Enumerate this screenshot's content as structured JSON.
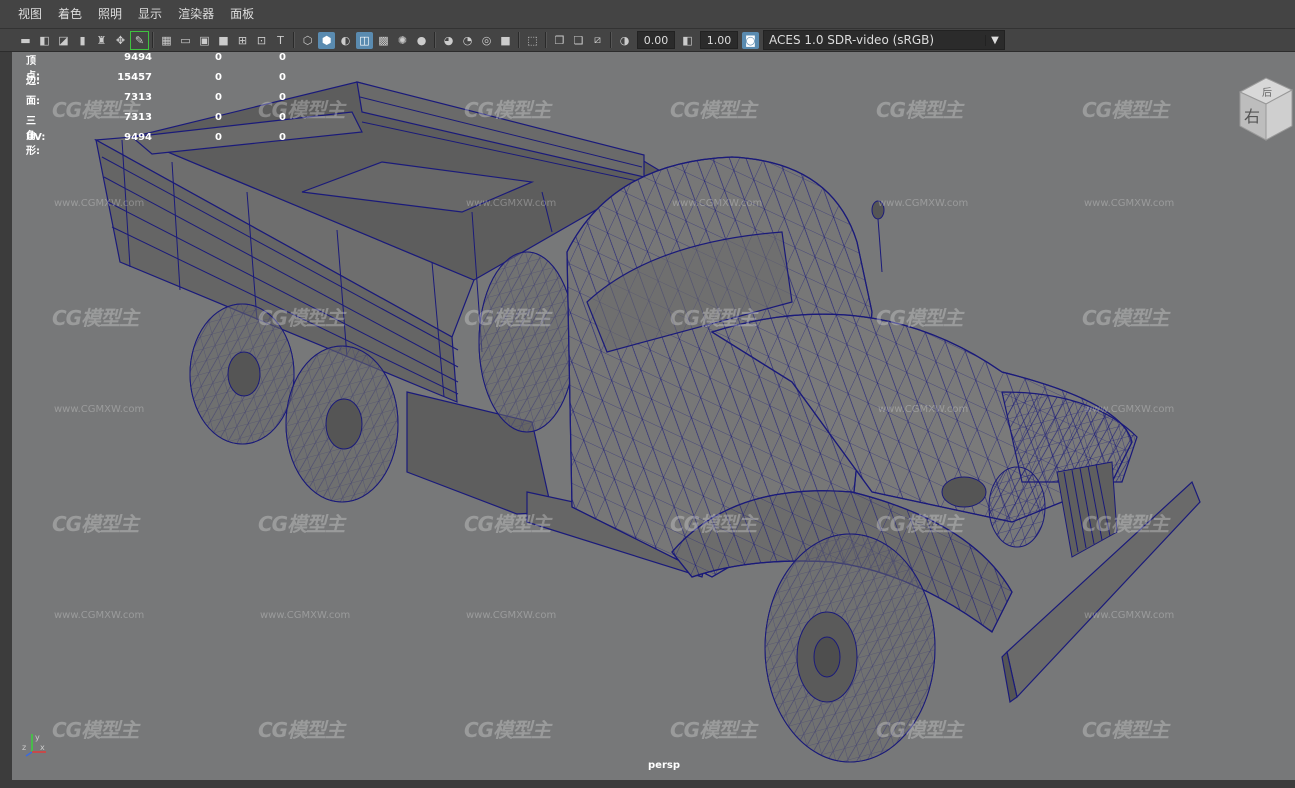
{
  "menu": [
    "视图",
    "着色",
    "照明",
    "显示",
    "渲染器",
    "面板"
  ],
  "toolbar": {
    "exposure_value": "0.00",
    "gamma_value": "1.00",
    "color_space": "ACES 1.0 SDR-video (sRGB)"
  },
  "hud": {
    "rows": [
      {
        "label": "顶点:",
        "v1": "9494",
        "v2": "0",
        "v3": "0"
      },
      {
        "label": "边:",
        "v1": "15457",
        "v2": "0",
        "v3": "0"
      },
      {
        "label": "面:",
        "v1": "7313",
        "v2": "0",
        "v3": "0"
      },
      {
        "label": "三角形:",
        "v1": "7313",
        "v2": "0",
        "v3": "0"
      },
      {
        "label": "UV:",
        "v1": "9494",
        "v2": "0",
        "v3": "0"
      }
    ]
  },
  "viewport": {
    "camera_label": "persp",
    "viewcube_front": "右",
    "viewcube_top": "后",
    "watermark_text": "CG模型主",
    "watermark_url": "www.CGMXW.com"
  },
  "colors": {
    "viewport_bg": "#777879",
    "wire": "#1a1a7a",
    "accent": "#5a8bb0"
  }
}
